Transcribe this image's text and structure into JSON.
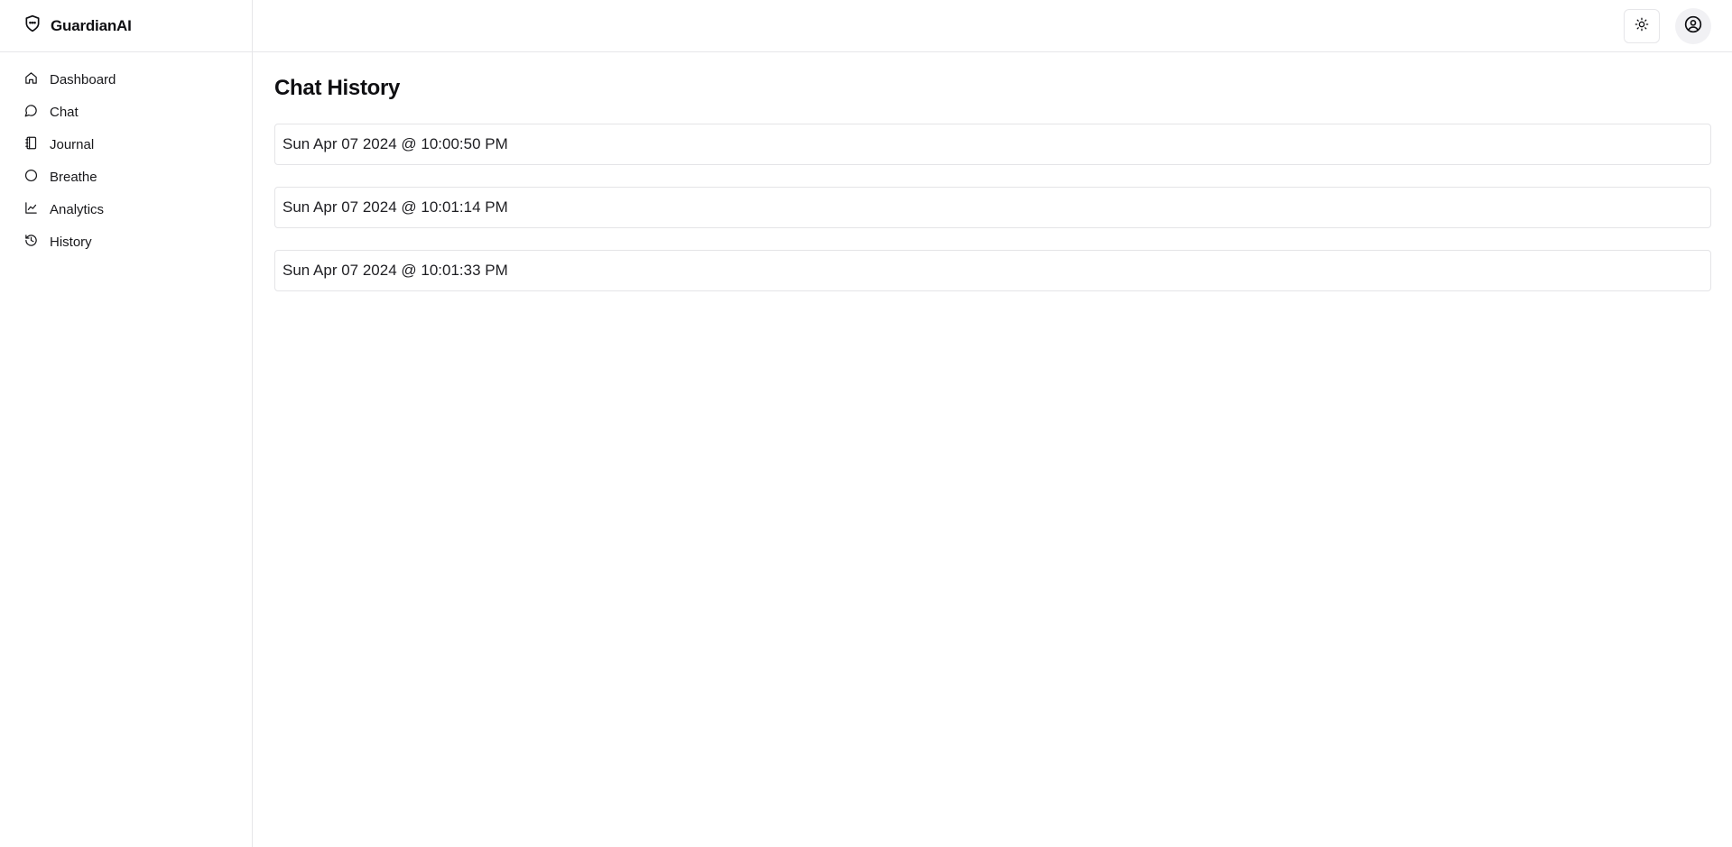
{
  "brand": {
    "name": "GuardianAI",
    "icon": "shield-icon"
  },
  "sidebar": {
    "items": [
      {
        "label": "Dashboard",
        "icon": "home-icon"
      },
      {
        "label": "Chat",
        "icon": "message-circle-icon"
      },
      {
        "label": "Journal",
        "icon": "notebook-icon"
      },
      {
        "label": "Breathe",
        "icon": "circle-icon"
      },
      {
        "label": "Analytics",
        "icon": "line-chart-icon"
      },
      {
        "label": "History",
        "icon": "history-icon"
      }
    ]
  },
  "header": {
    "theme_toggle_icon": "sun-icon",
    "user_icon": "user-circle-icon"
  },
  "main": {
    "title": "Chat History",
    "history": [
      {
        "label": "Sun Apr 07 2024 @ 10:00:50 PM"
      },
      {
        "label": "Sun Apr 07 2024 @ 10:01:14 PM"
      },
      {
        "label": "Sun Apr 07 2024 @ 10:01:33 PM"
      }
    ]
  },
  "colors": {
    "border": "#e6e6e9",
    "text": "#0f0f12",
    "avatar_bg": "#f1f1f4"
  }
}
